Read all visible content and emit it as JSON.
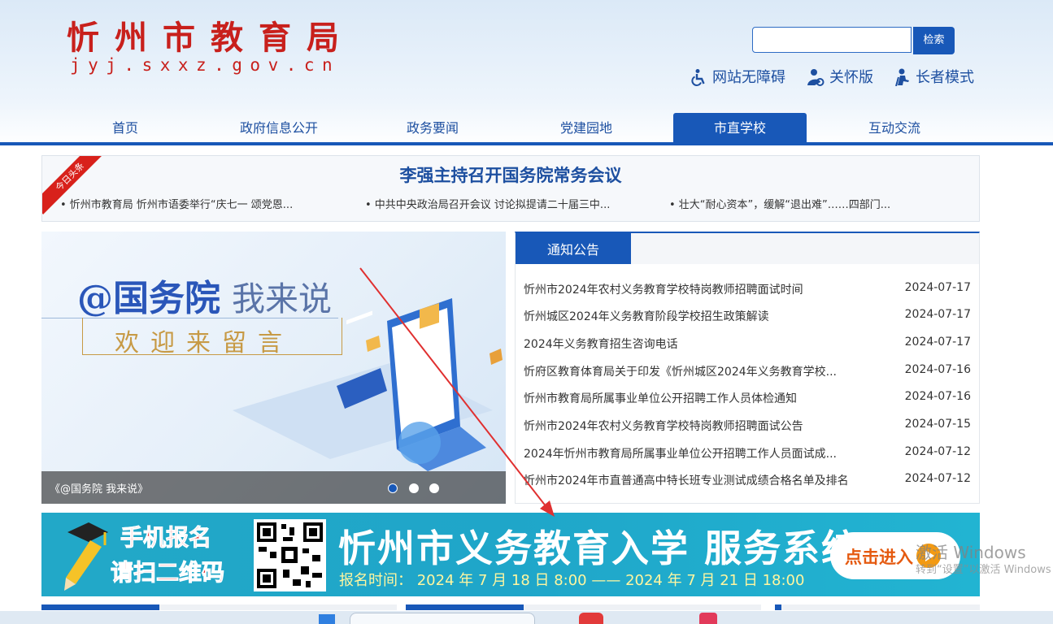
{
  "site": {
    "title": "忻州市教育局",
    "domain": "jyj.sxxz.gov.cn"
  },
  "search": {
    "placeholder": "",
    "button_label": "检索"
  },
  "tools": {
    "accessibility": "网站无障碍",
    "care_mode": "关怀版",
    "elder_mode": "长者模式"
  },
  "nav": {
    "items": [
      {
        "label": "首页"
      },
      {
        "label": "政府信息公开"
      },
      {
        "label": "政务要闻"
      },
      {
        "label": "党建园地"
      },
      {
        "label": "市直学校"
      },
      {
        "label": "互动交流"
      }
    ],
    "active": "市直学校"
  },
  "headline": {
    "badge": "今日头条",
    "title": "李强主持召开国务院常务会议",
    "subs": [
      "• 忻州市教育局 忻州市语委举行“庆七一 颂党恩...",
      "• 中共中央政治局召开会议 讨论拟提请二十届三中...",
      "• 壮大“耐心资本”，缓解“退出难”……四部门..."
    ]
  },
  "banner": {
    "line1_a": "@国务院",
    "line1_b": "我来说",
    "line2": "欢迎来留言",
    "caption": "《@国务院 我来说》",
    "slide_count": 3,
    "active_slide": 1
  },
  "notices": {
    "tab_label": "通知公告",
    "items": [
      {
        "title": "忻州市2024年农村义务教育学校特岗教师招聘面试时间",
        "date": "2024-07-17"
      },
      {
        "title": "忻州城区2024年义务教育阶段学校招生政策解读",
        "date": "2024-07-17"
      },
      {
        "title": "2024年义务教育招生咨询电话",
        "date": "2024-07-17"
      },
      {
        "title": "忻府区教育体育局关于印发《忻州城区2024年义务教育学校...",
        "date": "2024-07-16"
      },
      {
        "title": "忻州市教育局所属事业单位公开招聘工作人员体检通知",
        "date": "2024-07-16"
      },
      {
        "title": "忻州市2024年农村义务教育学校特岗教师招聘面试公告",
        "date": "2024-07-15"
      },
      {
        "title": "2024年忻州市教育局所属事业单位公开招聘工作人员面试成...",
        "date": "2024-07-12"
      },
      {
        "title": "忻州市2024年市直普通高中特长班专业测试成绩合格名单及排名",
        "date": "2024-07-12"
      }
    ]
  },
  "ad": {
    "scan_line1": "手机报名",
    "scan_line2": "请扫二维码",
    "title": "忻州市义务教育入学 服务系统",
    "time": "报名时间： 2024 年 7 月 18 日 8:00 —— 2024 年 7 月 21 日 18:00",
    "enter": "点击进入"
  },
  "watermark": {
    "line1": "激活 Windows",
    "line2": "转到“设置”以激活 Windows"
  },
  "colors": {
    "brand_red": "#c8201c",
    "brand_blue": "#1858b8",
    "link_blue": "#1d4fa0",
    "ad_teal": "#22a8c8",
    "annotation_arrow": "#e03030"
  }
}
